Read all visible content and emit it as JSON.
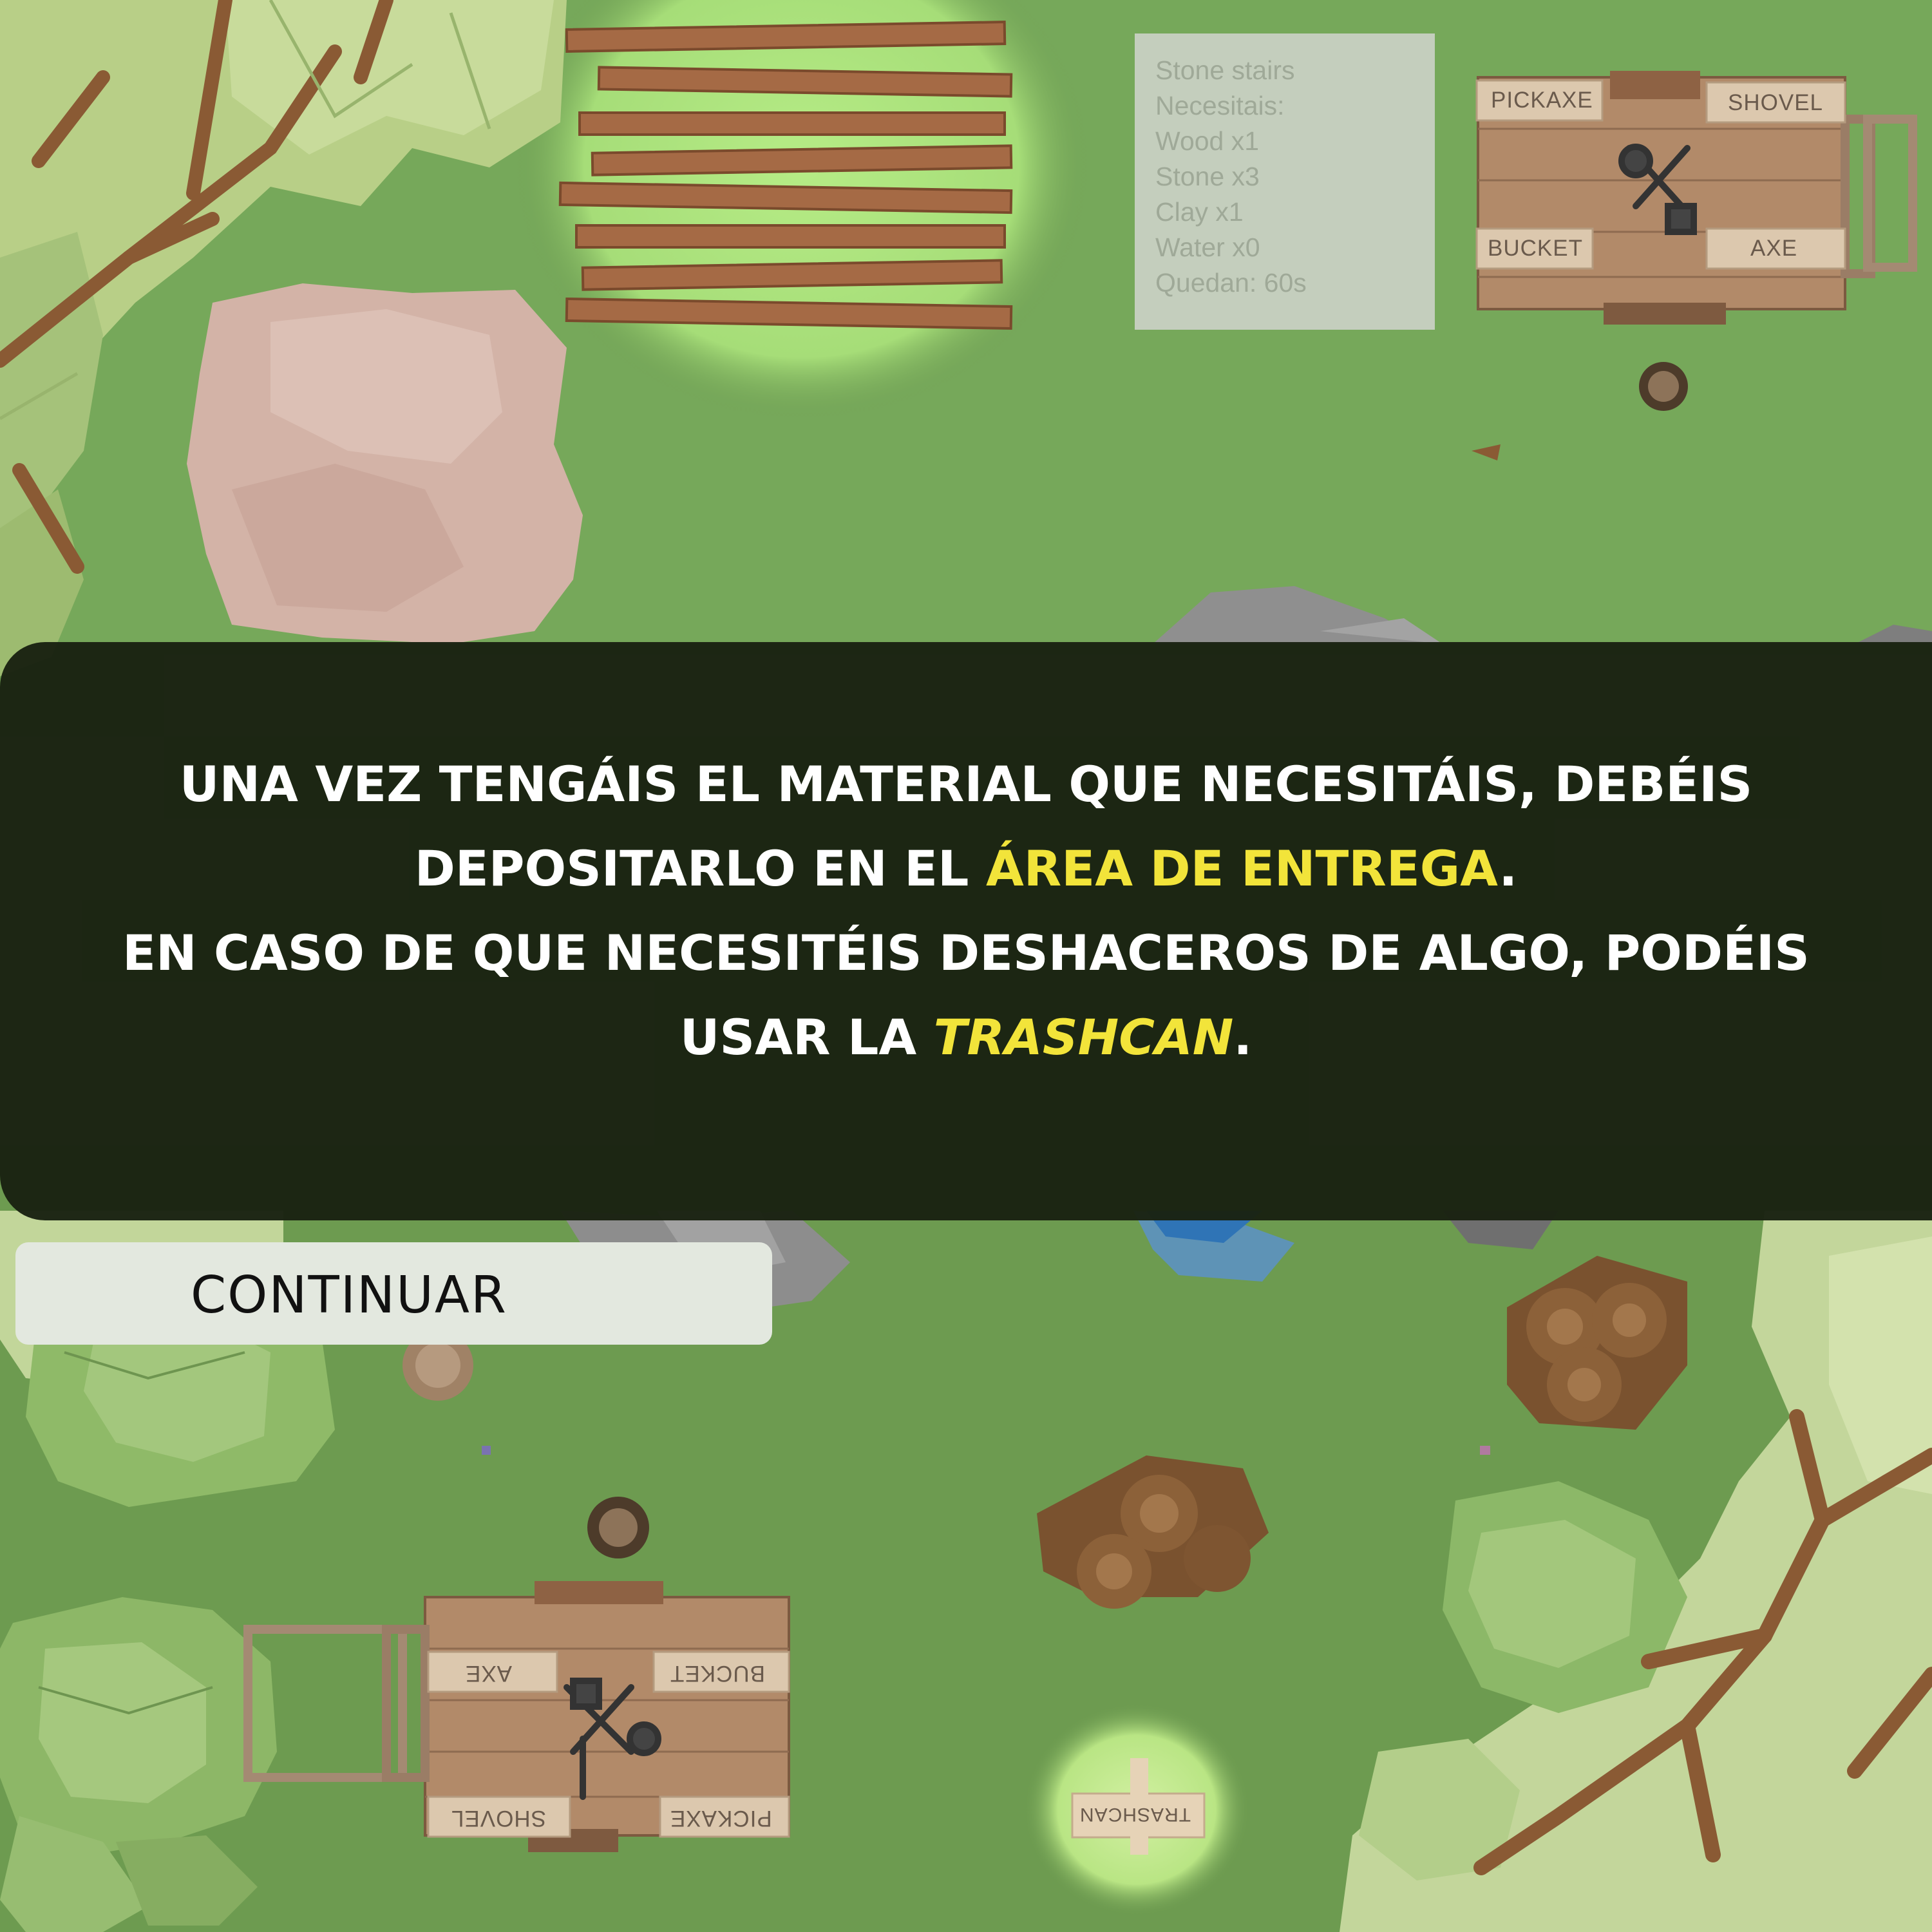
{
  "recipe": {
    "title": "Stone stairs",
    "needed_label": "Necesitais:",
    "items": [
      "Wood x1",
      "Stone x3",
      "Clay x1",
      "Water x0"
    ],
    "time_left": "Quedan: 60s"
  },
  "top_bench": {
    "pickaxe": "PICKAXE",
    "shovel": "SHOVEL",
    "bucket": "BUCKET",
    "axe": "AXE"
  },
  "bottom_bench": {
    "axe": "AXE",
    "bucket": "BUCKET",
    "shovel": "SHOVEL",
    "pickaxe": "PICKAXE"
  },
  "trashcan_sign": "TRASHCAN",
  "dialog": {
    "line1": "UNA VEZ TENGÁIS EL MATERIAL QUE NECESITÁIS, DEBÉIS",
    "line2_pre": "DEPOSITARLO EN EL ",
    "line2_highlight": "ÁREA DE ENTREGA",
    "line2_post": ".",
    "line3": "EN CASO DE QUE NECESITÉIS DESHACEROS DE ALGO, PODÉIS",
    "line4_pre": "USAR LA ",
    "line4_highlight": "TRASHCAN",
    "line4_post": "."
  },
  "continue_button": "CONTINUAR",
  "colors": {
    "grass": "#6d9b50",
    "overlay": "#1a2212",
    "highlight": "#f2e43a",
    "button": "#e3e8df"
  }
}
